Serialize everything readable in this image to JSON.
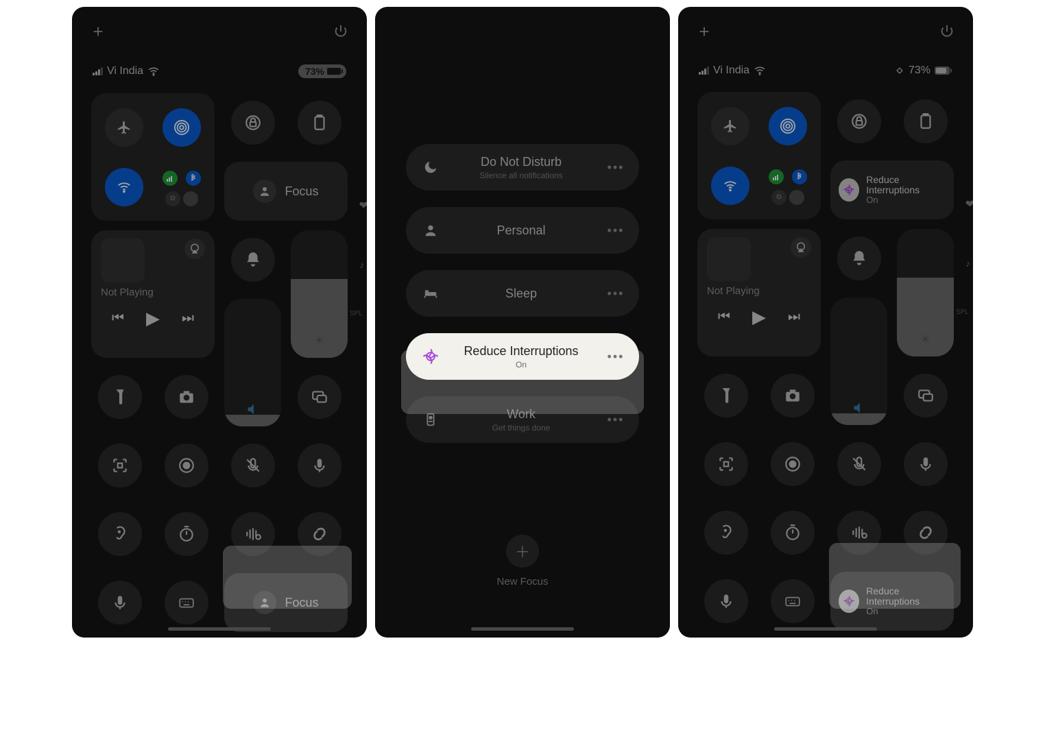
{
  "status": {
    "carrier": "Vi India",
    "battery": "73%"
  },
  "panel1": {
    "media_not_playing": "Not Playing",
    "focus_label": "Focus",
    "bottom_focus_label": "Focus"
  },
  "panel2": {
    "modes": [
      {
        "title": "Do Not Disturb",
        "subtitle": "Silence all notifications",
        "icon": "moon"
      },
      {
        "title": "Personal",
        "subtitle": "",
        "icon": "person"
      },
      {
        "title": "Sleep",
        "subtitle": "",
        "icon": "bed"
      },
      {
        "title": "Reduce Interruptions",
        "subtitle": "On",
        "icon": "ri",
        "active": true
      },
      {
        "title": "Work",
        "subtitle": "Get things done",
        "icon": "badge"
      }
    ],
    "new_focus": "New Focus"
  },
  "panel3": {
    "focus_tile_title": "Reduce Interruptions",
    "focus_tile_sub": "On",
    "bottom_focus_title": "Reduce Interruptions",
    "bottom_focus_sub": "On",
    "media_not_playing": "Not Playing"
  }
}
